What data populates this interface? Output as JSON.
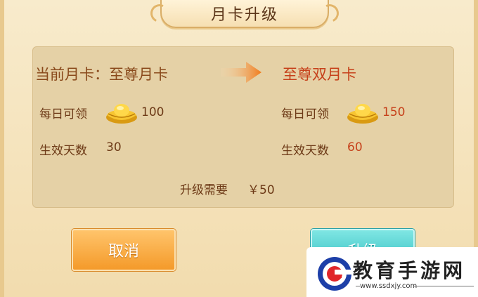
{
  "dialog": {
    "title": "月卡升级",
    "current": {
      "label": "当前月卡：至尊月卡",
      "daily_label": "每日可领",
      "daily_amount": "100",
      "days_label": "生效天数",
      "days_value": "30"
    },
    "target": {
      "label": "至尊双月卡",
      "daily_label": "每日可领",
      "daily_amount": "150",
      "days_label": "生效天数",
      "days_value": "60"
    },
    "cost_label": "升级需要",
    "cost_value": "￥50",
    "cancel_label": "取消",
    "upgrade_label": "升级"
  },
  "watermark": {
    "name": "教育手游网",
    "url": "www.ssdxjy.com"
  },
  "colors": {
    "title_brown": "#5a3418",
    "label_brown": "#8a4a1c",
    "highlight_red": "#c6401a",
    "cancel_orange": "#f49a2a",
    "upgrade_cyan": "#2fbcc0",
    "arrow_orange": "#f07a1a"
  },
  "icons": [
    "gold-ingot-icon",
    "arrow-right-icon"
  ]
}
